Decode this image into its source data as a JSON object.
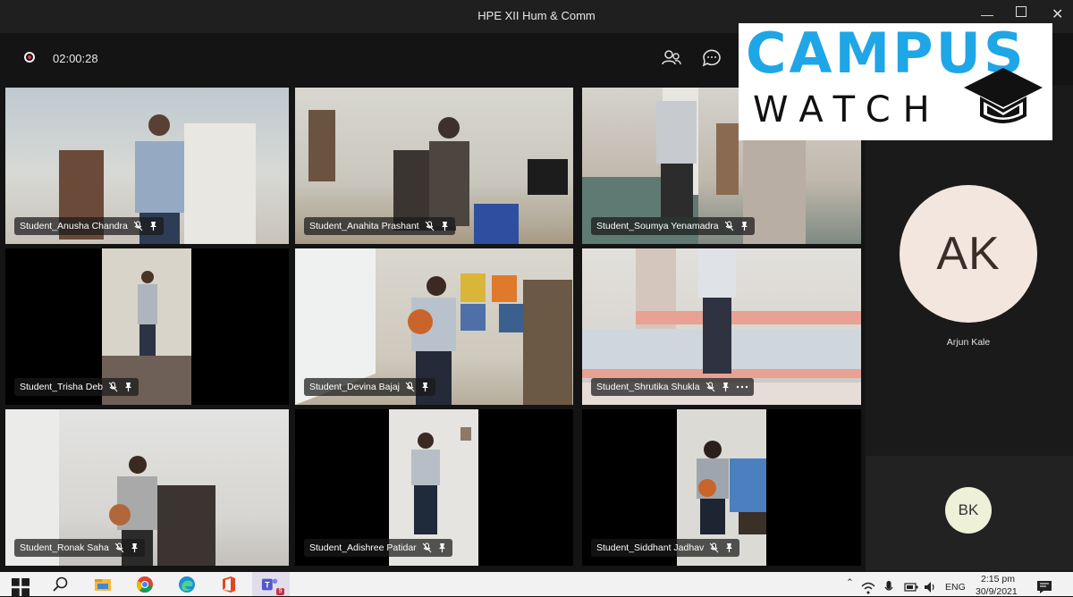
{
  "window": {
    "title": "HPE XII Hum & Comm",
    "controls": [
      "minimize-icon",
      "maximize-icon",
      "close-icon"
    ]
  },
  "toolbar": {
    "recording_time": "02:00:28",
    "icons": [
      "participants-icon",
      "chat-icon"
    ]
  },
  "participants": [
    {
      "name": "Student_Anusha Chandra"
    },
    {
      "name": "Student_Anahita Prashant"
    },
    {
      "name": "Student_Soumya Yenamadra"
    },
    {
      "name": "Student_Trisha Deb"
    },
    {
      "name": "Student_Devina Bajaj"
    },
    {
      "name": "Student_Shrutika Shukla"
    },
    {
      "name": "Student_Ronak Saha"
    },
    {
      "name": "Student_Adishree Patidar"
    },
    {
      "name": "Student_Siddhant Jadhav"
    }
  ],
  "side_panel": {
    "main_avatar_initials": "AK",
    "main_avatar_name": "Arjun Kale",
    "small_avatar_initials": "BK"
  },
  "watermark": {
    "line1": "CAMPUS",
    "line2": "WATCH"
  },
  "taskbar": {
    "language": "ENG",
    "time": "2:15 pm",
    "date": "30/9/2021",
    "badge": "9",
    "apps": [
      "windows-start-icon",
      "search-icon",
      "file-explorer-icon",
      "chrome-icon",
      "edge-icon",
      "office-icon",
      "teams-icon"
    ]
  },
  "colors": {
    "logo_blue": "#1fa6e6",
    "record_red": "#e3364f",
    "ak_avatar_bg": "#f3e6de",
    "bk_avatar_bg": "#eef0d7"
  }
}
